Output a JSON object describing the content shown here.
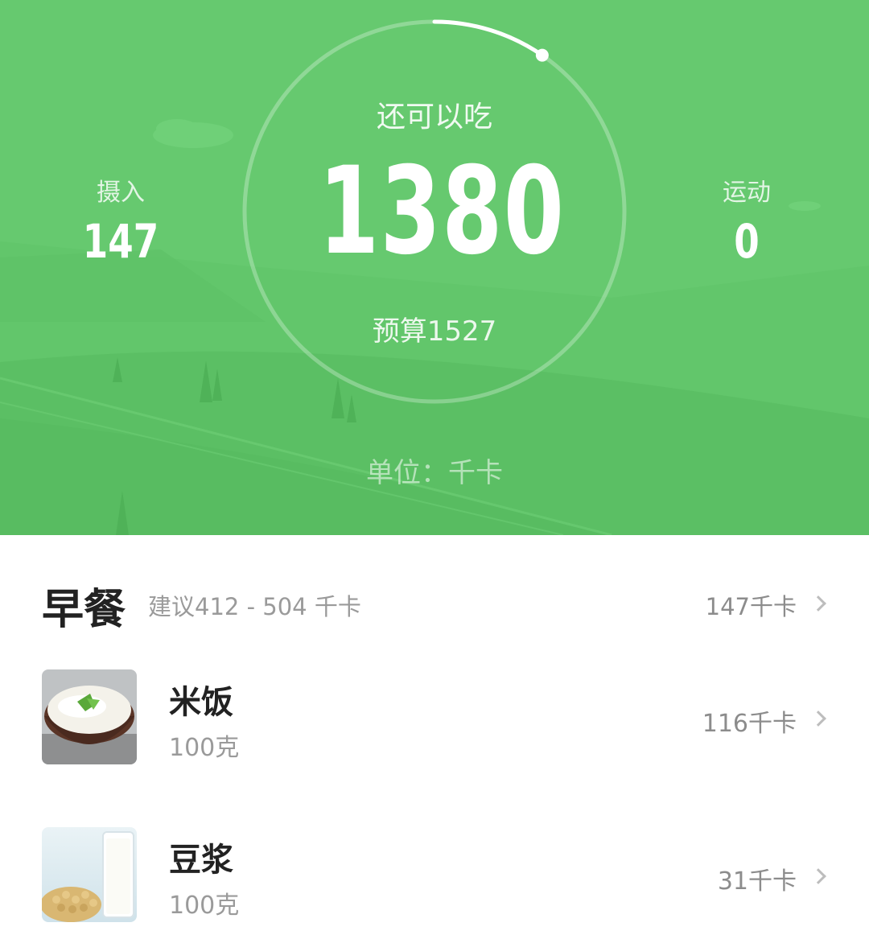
{
  "summary": {
    "remaining_label": "还可以吃",
    "remaining_value": "1380",
    "budget_text": "预算1527",
    "unit_text": "单位：千卡",
    "intake_label": "摄入",
    "intake_value": "147",
    "exercise_label": "运动",
    "exercise_value": "0",
    "consumed_fraction": 0.096
  },
  "meal": {
    "title": "早餐",
    "suggestion": "建议412 - 504 千卡",
    "total": "147千卡"
  },
  "foods": [
    {
      "name": "米饭",
      "amount": "100克",
      "calories": "116千卡",
      "icon": "rice-bowl-photo"
    },
    {
      "name": "豆浆",
      "amount": "100克",
      "calories": "31千卡",
      "icon": "soy-milk-photo"
    }
  ],
  "colors": {
    "hero_green": "#66c96f",
    "text_dark": "#222222",
    "text_gray": "#9a9a9a"
  }
}
